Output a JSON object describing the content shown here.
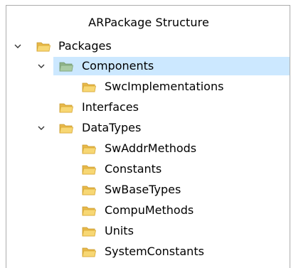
{
  "panel": {
    "title": "ARPackage Structure"
  },
  "colors": {
    "selection": "#cce8ff",
    "folder_fill": "#f5d36a",
    "folder_edge": "#d9a830",
    "folder_selected_fill": "#a5c8a0"
  },
  "tree": [
    {
      "label": "Packages",
      "expanded": true,
      "icon": "folder-icon"
    },
    {
      "label": "Components",
      "expanded": true,
      "selected": true,
      "icon": "folder-icon"
    },
    {
      "label": "SwcImplementations",
      "icon": "folder-icon"
    },
    {
      "label": "Interfaces",
      "icon": "folder-icon"
    },
    {
      "label": "DataTypes",
      "expanded": true,
      "icon": "folder-icon"
    },
    {
      "label": "SwAddrMethods",
      "icon": "folder-icon"
    },
    {
      "label": "Constants",
      "icon": "folder-icon"
    },
    {
      "label": "SwBaseTypes",
      "icon": "folder-icon"
    },
    {
      "label": "CompuMethods",
      "icon": "folder-icon"
    },
    {
      "label": "Units",
      "icon": "folder-icon"
    },
    {
      "label": "SystemConstants",
      "icon": "folder-icon"
    }
  ]
}
